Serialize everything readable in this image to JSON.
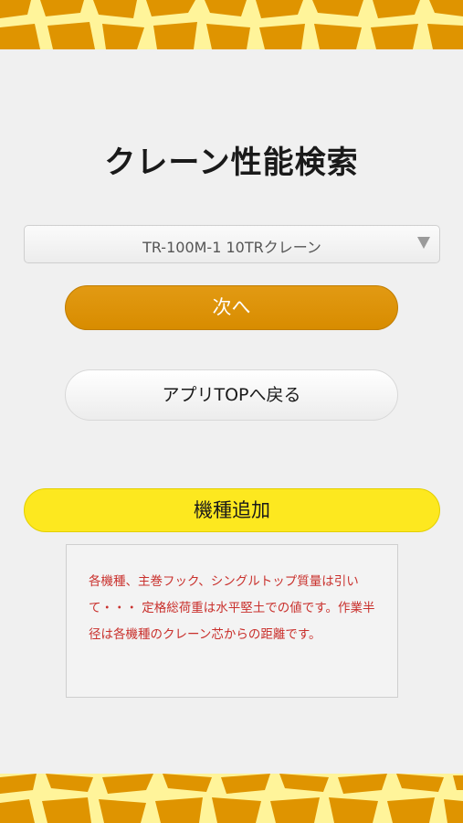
{
  "header": {
    "title": "クレーン性能検索"
  },
  "model_select": {
    "value": "TR-100M-1 10TRクレーン",
    "arrow_icon": "triangle-down-icon"
  },
  "buttons": {
    "next_label": "次へ",
    "back_label": "アプリTOPへ戻る",
    "add_model_label": "機種追加"
  },
  "note": {
    "text": "各機種、主巻フック、シングルトップ質量は引いて・・・ 定格総荷重は水平堅土での値です。作業半径は各機種のクレーン芯からの距離です。"
  },
  "colors": {
    "giraffe_spot": "#df9400",
    "giraffe_line": "#fff49a",
    "next_button": "#d88c00",
    "add_button": "#fde81f",
    "note_text": "#c9302c"
  }
}
